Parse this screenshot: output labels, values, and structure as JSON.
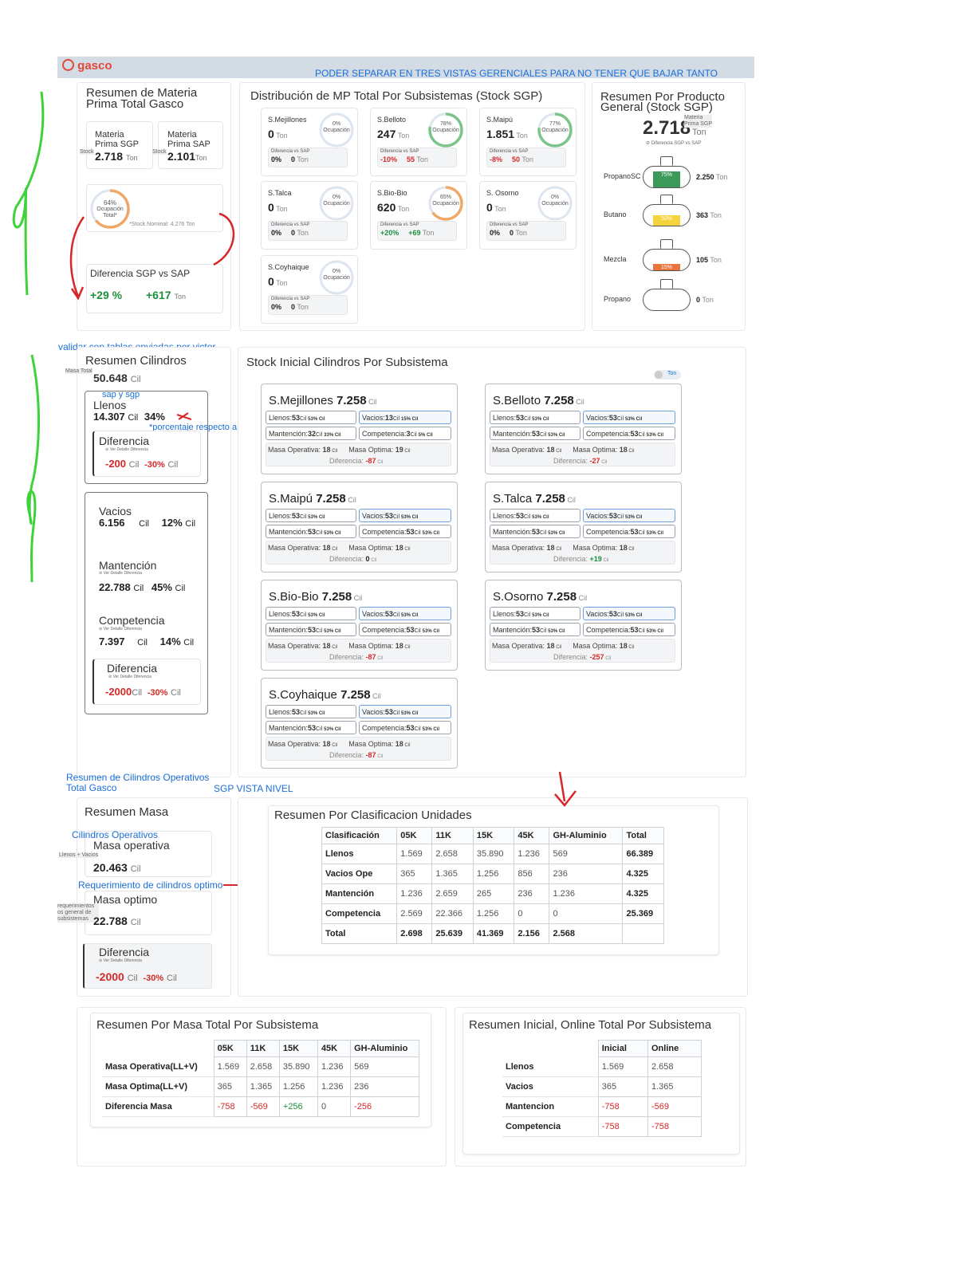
{
  "header": {
    "logo": "gasco",
    "note": "PODER SEPARAR EN TRES VISTAS GERENCIALES PARA NO TENER QUE BAJAR TANTO",
    "bar_color": "#d3dbe4"
  },
  "mp_total": {
    "title_l1": "Resumen de Materia",
    "title_l2": "Prima Total Gasco",
    "sgp_l1": "Materia",
    "sgp_l2": "Prima SGP",
    "sgp_tag": "Stock",
    "sgp_value": "2.718",
    "sgp_unit": "Ton",
    "sap_l1": "Materia",
    "sap_l2": "Prima SAP",
    "sap_tag": "Stock",
    "sap_value": "2.101",
    "sap_unit": "Ton",
    "ring_pct": "64%",
    "ring_label1": "Ocupación",
    "ring_label2": "Total*",
    "ring_fill": 0.64,
    "stock_nominal": "*Stock Nominal: 4.276 Ton",
    "diff_title": "Diferencia SGP vs SAP",
    "diff_pct": "+29 %",
    "diff_val": "+617",
    "diff_unit": "Ton"
  },
  "dist": {
    "title": "Distribución de MP Total Por Subsistemas (Stock SGP)",
    "diff_label": "Diferencia vs SAP",
    "ocup": "Ocupación",
    "unit": "Ton",
    "items": [
      {
        "name": "S.Mejillones",
        "value": "0",
        "pct": "0%",
        "fill": 0,
        "color": "#a9c7ee",
        "dpct": "0%",
        "dval": "0",
        "dcolor": "#222"
      },
      {
        "name": "S.Belloto",
        "value": "247",
        "pct": "78%",
        "fill": 0.78,
        "color": "#7bc48a",
        "dpct": "-10%",
        "dval": "55",
        "dcolor": "#d62828"
      },
      {
        "name": "S.Maipú",
        "value": "1.851",
        "pct": "77%",
        "fill": 0.77,
        "color": "#7bc48a",
        "dpct": "-8%",
        "dval": "50",
        "dcolor": "#d62828"
      },
      {
        "name": "S.Talca",
        "value": "0",
        "pct": "0%",
        "fill": 0,
        "color": "#a9c7ee",
        "dpct": "0%",
        "dval": "0",
        "dcolor": "#222"
      },
      {
        "name": "S.Bio-Bio",
        "value": "620",
        "pct": "65%",
        "fill": 0.65,
        "color": "#f0a868",
        "dpct": "+20%",
        "dval": "+69",
        "dcolor": "#1e8f3c"
      },
      {
        "name": "S. Osorno",
        "value": "0",
        "pct": "0%",
        "fill": 0,
        "color": "#a9c7ee",
        "dpct": "0%",
        "dval": "0",
        "dcolor": "#222"
      },
      {
        "name": "S.Coyhaique",
        "value": "0",
        "pct": "0%",
        "fill": 0,
        "color": "#a9c7ee",
        "dpct": "0%",
        "dval": "0",
        "dcolor": "#222"
      }
    ]
  },
  "producto": {
    "title_l1": "Resumen Por Producto",
    "title_l2": "General (Stock SGP)",
    "total": "2.718",
    "tag_l1": "Materia",
    "tag_l2": "Prima SGP",
    "unit": "Ton",
    "sub": "Diferencia SGP vs SAP",
    "items": [
      {
        "name": "PropanoSC",
        "value": "2.250",
        "unit": "Ton",
        "pct": "75%",
        "fill": 0.75,
        "color": "#3c9a5a"
      },
      {
        "name": "Butano",
        "value": "363",
        "unit": "Ton",
        "pct": "50%",
        "fill": 0.5,
        "color": "#f5d33b"
      },
      {
        "name": "Mezcla",
        "value": "105",
        "unit": "Ton",
        "pct": "15%",
        "fill": 0.3,
        "color": "#e8743b"
      },
      {
        "name": "Propano",
        "value": "0",
        "unit": "Ton",
        "pct": "",
        "fill": 0,
        "color": "#ffffff"
      }
    ]
  },
  "cil": {
    "note_top": "validar con tablas enviadas por victor",
    "title": "Resumen Cilindros",
    "masa_tag": "Masa Total",
    "total": "50.648",
    "unit": "Cil",
    "sap_note": "sap  y sgp",
    "llenos_label": "Llenos",
    "llenos_val": "14.307",
    "llenos_pct": "34%",
    "pct_note": "*porcentaje respecto a la masa total",
    "diff1_title": "Diferencia",
    "ver": "Ver Detalle Diferencia",
    "diff1_val": "-200",
    "diff1_pct": "-30%",
    "vacios_label": "Vacios",
    "vacios_val": "6.156",
    "vacios_pct": "12%",
    "mant_label": "Mantención",
    "mant_val": "22.788",
    "mant_pct": "45%",
    "comp_label": "Competencia",
    "comp_val": "7.397",
    "comp_pct": "14%",
    "diff2_title": "Diferencia",
    "diff2_val": "-2000",
    "diff2_pct": "-30%",
    "note_bottom_l1": "Resumen de Cilindros Operativos",
    "note_bottom_l2": "Total Gasco"
  },
  "stock": {
    "title": "Stock Inicial Cilindros Por Subsistema",
    "toggle": "Ton",
    "llenos": "Llenos:",
    "vacios": "Vacios:",
    "mant": "Mantención:",
    "comp": "Competencia:",
    "mop": "Masa Operativa:",
    "mopt": "Masa Optima:",
    "diff": "Diferencia:",
    "cil": "Cil",
    "items": [
      {
        "name": "S.Mejillones",
        "total": "7.258",
        "ll": "53",
        "llp": "53%",
        "va": "13",
        "vap": "15%",
        "ma": "32",
        "map": "33%",
        "co": "3",
        "cop": "5%",
        "mo": "18",
        "mp": "19",
        "df": "-87",
        "dc": "#d62828"
      },
      {
        "name": "S.Belloto",
        "total": "7.258",
        "ll": "53",
        "llp": "53%",
        "va": "53",
        "vap": "53%",
        "ma": "53",
        "map": "53%",
        "co": "53",
        "cop": "53%",
        "mo": "18",
        "mp": "18",
        "df": "-27",
        "dc": "#d62828"
      },
      {
        "name": "S.Maipú",
        "total": "7.258",
        "ll": "53",
        "llp": "53%",
        "va": "53",
        "vap": "53%",
        "ma": "53",
        "map": "53%",
        "co": "53",
        "cop": "53%",
        "mo": "18",
        "mp": "18",
        "df": "0",
        "dc": "#222"
      },
      {
        "name": "S.Talca",
        "total": "7.258",
        "ll": "53",
        "llp": "53%",
        "va": "53",
        "vap": "53%",
        "ma": "53",
        "map": "53%",
        "co": "53",
        "cop": "53%",
        "mo": "18",
        "mp": "18",
        "df": "+19",
        "dc": "#1e8f3c"
      },
      {
        "name": "S.Bio-Bio",
        "total": "7.258",
        "ll": "53",
        "llp": "53%",
        "va": "53",
        "vap": "53%",
        "ma": "53",
        "map": "53%",
        "co": "53",
        "cop": "53%",
        "mo": "18",
        "mp": "18",
        "df": "-87",
        "dc": "#d62828"
      },
      {
        "name": "S.Osorno",
        "total": "7.258",
        "ll": "53",
        "llp": "53%",
        "va": "53",
        "vap": "53%",
        "ma": "53",
        "map": "53%",
        "co": "53",
        "cop": "53%",
        "mo": "18",
        "mp": "18",
        "df": "-257",
        "dc": "#d62828"
      },
      {
        "name": "S.Coyhaique",
        "total": "7.258",
        "ll": "53",
        "llp": "53%",
        "va": "53",
        "vap": "53%",
        "ma": "53",
        "map": "53%",
        "co": "53",
        "cop": "53%",
        "mo": "18",
        "mp": "18",
        "df": "-87",
        "dc": "#d62828"
      }
    ]
  },
  "masa": {
    "note_sgp": "SGP VISTA NIVEL",
    "title": "Resumen Masa",
    "note_ops": "Cilindros Operativos",
    "mop_label": "Masa operativa",
    "mop_tag": "Llenos + Vacios",
    "mop_val": "20.463",
    "unit": "Cil",
    "note_req": "Requerimiento de cilindros optimo",
    "mopt_label": "Masa optimo",
    "mopt_tag": "requerimientos os general de subsistemas",
    "mopt_val": "22.788",
    "diff_title": "Diferencia",
    "ver": "Ver Detalle Diferencia",
    "diff_val": "-2000",
    "diff_pct": "-30%"
  },
  "clasif": {
    "title": "Resumen Por Clasificacion Unidades",
    "headers": [
      "Clasificación",
      "05K",
      "11K",
      "15K",
      "45K",
      "GH-Aluminio",
      "Total"
    ],
    "rows": [
      [
        "Llenos",
        "1.569",
        "2.658",
        "35.890",
        "1.236",
        "569",
        "66.389"
      ],
      [
        "Vacios Ope",
        "365",
        "1.365",
        "1.256",
        "856",
        "236",
        "4.325"
      ],
      [
        "Mantención",
        "1.236",
        "2.659",
        "265",
        "236",
        "1.236",
        "4.325"
      ],
      [
        "Competencia",
        "2.569",
        "22.366",
        "1.256",
        "0",
        "0",
        "25.369"
      ],
      [
        "Total",
        "2.698",
        "25.639",
        "41.369",
        "2.156",
        "2.568",
        ""
      ]
    ]
  },
  "masa_total": {
    "title": "Resumen Por Masa Total Por Subsistema",
    "headers": [
      "",
      "05K",
      "11K",
      "15K",
      "45K",
      "GH-Aluminio"
    ],
    "rows": [
      [
        "Masa Operativa(LL+V)",
        "1.569",
        "2.658",
        "35.890",
        "1.236",
        "569"
      ],
      [
        "Masa Optima(LL+V)",
        "365",
        "1.365",
        "1.256",
        "1.236",
        "236"
      ],
      [
        "Diferencia Masa",
        "-758",
        "-569",
        "+256",
        "0",
        "-256"
      ]
    ]
  },
  "inicial": {
    "title": "Resumen Inicial, Online Total Por Subsistema",
    "headers": [
      "",
      "Inicial",
      "Online"
    ],
    "rows": [
      [
        "Llenos",
        "1.569",
        "2.658"
      ],
      [
        "Vacios",
        "365",
        "1.365"
      ],
      [
        "Mantencion",
        "-758",
        "-569"
      ],
      [
        "Competencia",
        "-758",
        "-758"
      ]
    ]
  }
}
